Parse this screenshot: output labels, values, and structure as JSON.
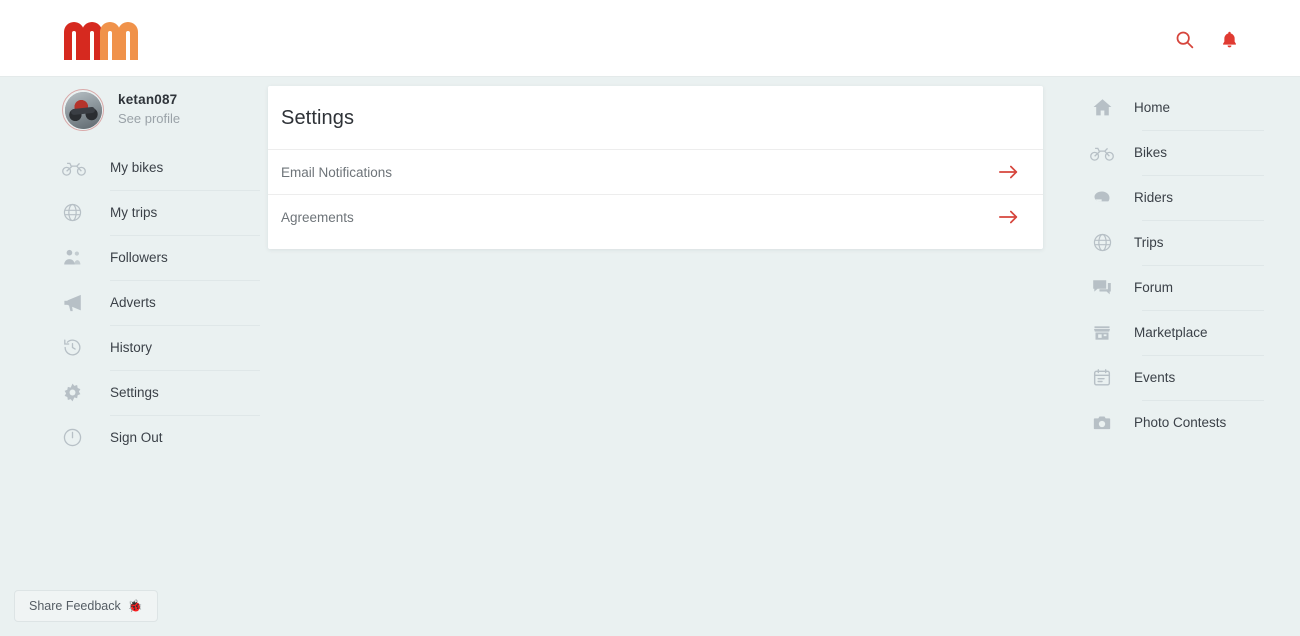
{
  "brand": {
    "logo_text": "mm",
    "logo_color_primary": "#d6291f",
    "logo_color_secondary": "#f0924a"
  },
  "header": {
    "search_icon": "search-icon",
    "notifications_icon": "bell-icon",
    "accent_color": "#d6453c"
  },
  "sidebar": {
    "profile": {
      "username": "ketan087",
      "subtitle": "See profile",
      "avatar_icon": "avatar"
    },
    "items": [
      {
        "label": "My bikes",
        "icon": "motorcycle-icon"
      },
      {
        "label": "My trips",
        "icon": "globe-icon"
      },
      {
        "label": "Followers",
        "icon": "followers-icon"
      },
      {
        "label": "Adverts",
        "icon": "megaphone-icon"
      },
      {
        "label": "History",
        "icon": "history-icon"
      },
      {
        "label": "Settings",
        "icon": "gear-icon"
      },
      {
        "label": "Sign Out",
        "icon": "power-icon"
      }
    ],
    "feedback": {
      "label": "Share Feedback",
      "icon": "bug-icon",
      "emoji": "🐞"
    }
  },
  "main": {
    "title": "Settings",
    "rows": [
      {
        "label": "Email Notifications",
        "arrow_icon": "arrow-right-icon"
      },
      {
        "label": "Agreements",
        "arrow_icon": "arrow-right-icon"
      }
    ]
  },
  "right_nav": {
    "items": [
      {
        "label": "Home",
        "icon": "home-icon"
      },
      {
        "label": "Bikes",
        "icon": "motorcycle-icon"
      },
      {
        "label": "Riders",
        "icon": "helmet-icon"
      },
      {
        "label": "Trips",
        "icon": "globe-icon"
      },
      {
        "label": "Forum",
        "icon": "forum-icon"
      },
      {
        "label": "Marketplace",
        "icon": "storefront-icon"
      },
      {
        "label": "Events",
        "icon": "calendar-icon"
      },
      {
        "label": "Photo Contests",
        "icon": "camera-icon"
      }
    ]
  }
}
